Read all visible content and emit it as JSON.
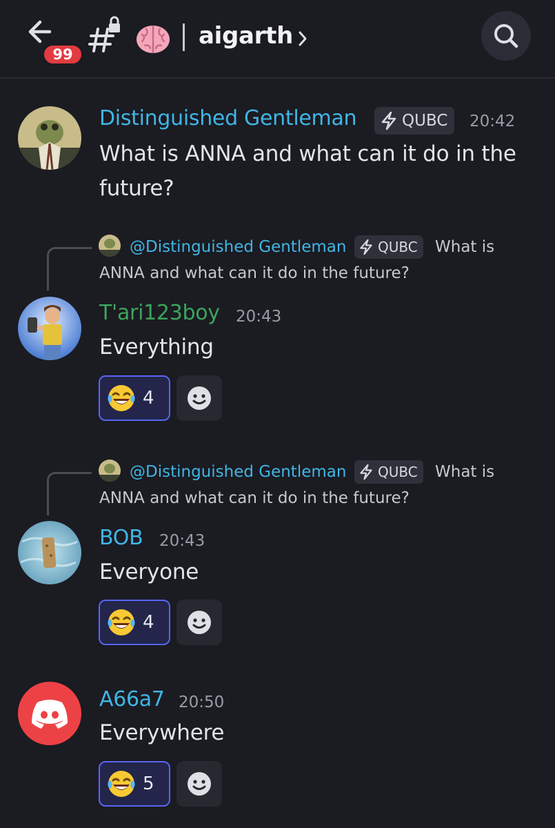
{
  "header": {
    "unread_badge": "99",
    "channel_name": "aigarth"
  },
  "messages": [
    {
      "username": "Distinguished Gentleman",
      "username_color": "#3fb6e4",
      "tag": "QUBC",
      "time": "20:42",
      "text": "What is ANNA and what can it do in the future?"
    },
    {
      "reply": {
        "mention": "@Distinguished Gentleman",
        "tag": "QUBC",
        "text_line1": "What is",
        "text_line2": "ANNA and what can it do in the future?"
      },
      "username": "T'ari123boy",
      "username_color": "#3ba55c",
      "time": "20:43",
      "text": "Everything",
      "reaction": {
        "emoji": "😂",
        "count": "4"
      }
    },
    {
      "reply": {
        "mention": "@Distinguished Gentleman",
        "tag": "QUBC",
        "text_line1": "What is",
        "text_line2": "ANNA and what can it do in the future?"
      },
      "username": "BOB",
      "username_color": "#3fb6e4",
      "time": "20:43",
      "text": "Everyone",
      "reaction": {
        "emoji": "😂",
        "count": "4"
      }
    },
    {
      "username": "A66a7",
      "username_color": "#3fb6e4",
      "time": "20:50",
      "text": "Everywhere",
      "reaction": {
        "emoji": "😂",
        "count": "5"
      }
    }
  ],
  "colors": {
    "background": "#1b1b22",
    "mention": "#3fb6e4",
    "reaction_border": "#5865f2",
    "discord_red": "#ed4245"
  },
  "icons": [
    "back-arrow-icon",
    "hash-lock-icon",
    "brain-icon",
    "chevron-right-icon",
    "search-icon",
    "lightning-icon",
    "add-reaction-icon",
    "discord-logo-icon"
  ]
}
